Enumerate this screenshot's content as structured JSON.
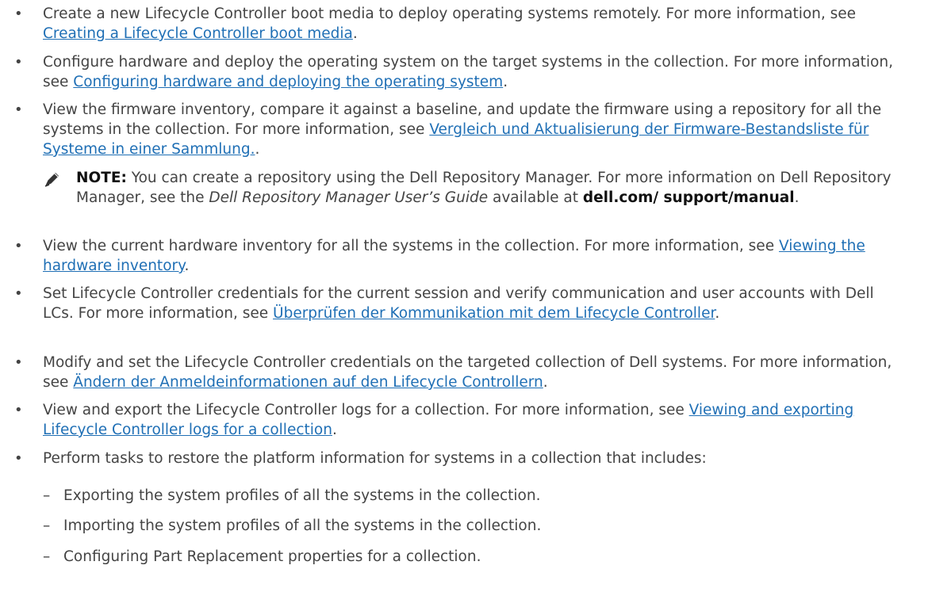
{
  "items": [
    {
      "text": "Create a new Lifecycle Controller boot media to deploy operating systems remotely. For more information, see ",
      "link": "Creating a Lifecycle Controller boot media",
      "after": "."
    },
    {
      "text": "Configure hardware and deploy the operating system on the target systems in the collection. For more information, see ",
      "link": "Configuring hardware and deploying the operating system",
      "after": "."
    },
    {
      "text": "View the firmware inventory, compare it against a baseline, and update the firmware using a repository for all the systems in the collection. For more information, see ",
      "link": "Vergleich und Aktualisierung der Firmware-Bestandsliste für Systeme in einer Sammlung.",
      "after": "."
    },
    {
      "text": "View the current hardware inventory for all the systems in the collection. For more information, see ",
      "link": "Viewing the hardware inventory",
      "after": "."
    },
    {
      "text": "Set Lifecycle Controller credentials for the current session and verify communication and user accounts with Dell LCs. For more information, see ",
      "link": "Überprüfen der Kommunikation mit dem Lifecycle Controller",
      "after": "."
    },
    {
      "text": "Modify and set the Lifecycle Controller credentials on the targeted collection of Dell systems. For more information, see ",
      "link": "Ändern der Anmeldeinformationen auf den Lifecycle Controllern",
      "after": "."
    },
    {
      "text": "View and export the Lifecycle Controller logs for a collection. For more information, see ",
      "link": "Viewing and exporting Lifecycle Controller logs for a collection",
      "after": "."
    },
    {
      "text": "Perform tasks to restore the platform information for systems in a collection that includes:",
      "link": "",
      "after": ""
    }
  ],
  "note": {
    "label": "NOTE:",
    "text1": " You can create a repository using the Dell Repository Manager. For more information on Dell Repository Manager, see the ",
    "guide": "Dell Repository Manager User’s Guide",
    "text2": " available at ",
    "site": "dell.com/ support/manual",
    "end": "."
  },
  "subitems": [
    "Exporting the system profiles of all the systems in the collection.",
    "Importing the system profiles of all the systems in the collection.",
    "Configuring Part Replacement properties for a collection."
  ]
}
